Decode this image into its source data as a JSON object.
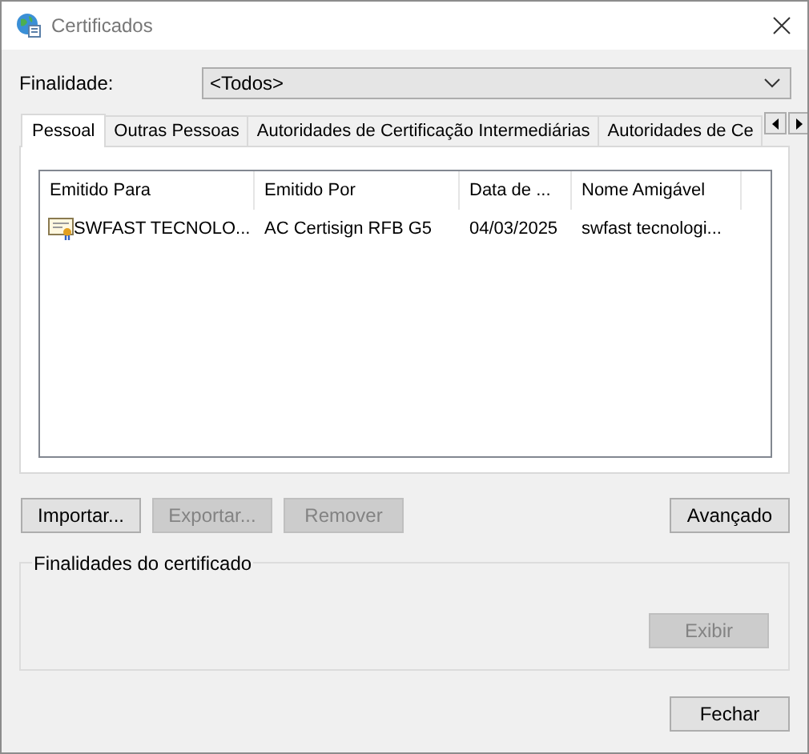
{
  "window": {
    "title": "Certificados"
  },
  "purpose": {
    "label": "Finalidade:",
    "value": "<Todos>"
  },
  "tabs": [
    {
      "label": "Pessoal",
      "selected": true
    },
    {
      "label": "Outras Pessoas",
      "selected": false
    },
    {
      "label": "Autoridades de Certificação Intermediárias",
      "selected": false
    },
    {
      "label": "Autoridades de Ce",
      "selected": false
    }
  ],
  "table": {
    "columns": [
      "Emitido Para",
      "Emitido Por",
      "Data de ...",
      "Nome Amigável"
    ],
    "rows": [
      [
        "SWFAST TECNOLO...",
        "AC Certisign RFB G5",
        "04/03/2025",
        "swfast tecnologi..."
      ]
    ]
  },
  "buttons": [
    {
      "label": "Importar...",
      "disabled": false
    },
    {
      "label": "Exportar...",
      "disabled": true
    },
    {
      "label": "Remover",
      "disabled": true
    },
    {
      "label": "Avançado",
      "disabled": false
    }
  ],
  "purposes_group": {
    "title": "Finalidades do certificado",
    "button": {
      "label": "Exibir",
      "disabled": true
    }
  },
  "close_button": {
    "label": "Fechar",
    "disabled": false
  }
}
